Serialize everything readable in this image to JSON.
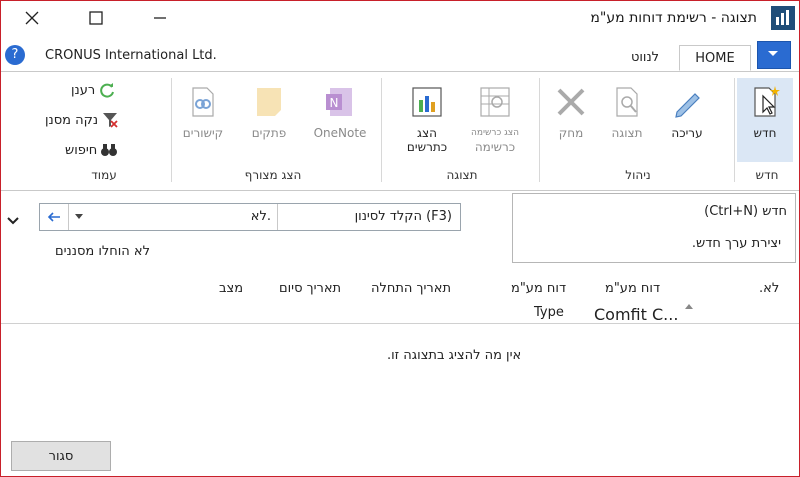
{
  "window": {
    "title": "תצוגה - רשימת דוחות מע\"מ",
    "company": "CRONUS International Ltd."
  },
  "tabs": {
    "home": "HOME",
    "navigate": "לנווט"
  },
  "ribbon": {
    "groups": {
      "new": "חדש",
      "manage": "ניהול",
      "view": "תצוגה",
      "attachments": "הצג מצורף",
      "page": "עמוד"
    },
    "buttons": {
      "new": "חדש",
      "edit": "עריכה",
      "view": "תצוגה",
      "delete": "מחק",
      "list_view_small": "הצג כרשימה",
      "list_view": "כרשימה",
      "show_charts_1": "הצג",
      "show_charts_2": "כתרשים",
      "onenote": "OneNote",
      "notes": "פתקים",
      "links": "קישורים",
      "refresh": "רענן",
      "clear_filter": "נקה מסנן",
      "find": "חיפוש"
    }
  },
  "tooltip": {
    "title": "חדש (Ctrl+N)",
    "description": "יצירת ערך חדש."
  },
  "filter": {
    "field_value": "לא.",
    "placeholder": "הקלד לסינון (F3)",
    "status": "לא הוחלו מסננים"
  },
  "columns": {
    "no": "לא.",
    "vat_report_config": "דוח מע\"מ",
    "vat_report_config_sub": "Comfit C...",
    "vat_report_type": "דוח מע\"מ",
    "vat_report_type_sub": "Type",
    "start_date": "תאריך התחלה",
    "end_date": "תאריך סיום",
    "status": "מצב"
  },
  "empty_message": "אין מה להציג בתצוגה זו.",
  "footer": {
    "close": "סגור"
  },
  "colors": {
    "accent": "#2a6bd1",
    "border": "#c8202a"
  }
}
